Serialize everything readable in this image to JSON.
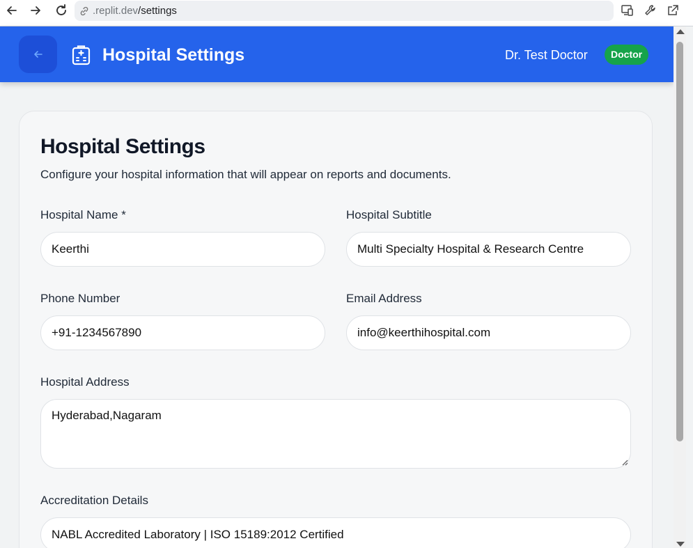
{
  "browser": {
    "url_host": ".replit.dev",
    "url_path": "/settings"
  },
  "header": {
    "title": "Hospital Settings",
    "user_name": "Dr. Test Doctor",
    "role_badge": "Doctor"
  },
  "page": {
    "title": "Hospital Settings",
    "description": "Configure your hospital information that will appear on reports and documents."
  },
  "form": {
    "hospital_name": {
      "label": "Hospital Name *",
      "value": "Keerthi"
    },
    "hospital_subtitle": {
      "label": "Hospital Subtitle",
      "value": "Multi Specialty Hospital & Research Centre"
    },
    "phone_number": {
      "label": "Phone Number",
      "value": "+91-1234567890"
    },
    "email_address": {
      "label": "Email Address",
      "value": "info@keerthihospital.com"
    },
    "hospital_address": {
      "label": "Hospital Address",
      "value": "Hyderabad,Nagaram"
    },
    "accreditation": {
      "label": "Accreditation Details",
      "value": "NABL Accredited Laboratory | ISO 15189:2012 Certified"
    }
  },
  "colors": {
    "header_bg": "#2563eb",
    "back_button_bg": "#1d4fd8",
    "badge_bg": "#16a34a"
  },
  "icons": [
    "arrow-left-icon",
    "arrow-right-icon",
    "reload-icon",
    "link-icon",
    "devices-icon",
    "wrench-icon",
    "open-external-icon",
    "back-arrow-icon",
    "hospital-icon"
  ]
}
